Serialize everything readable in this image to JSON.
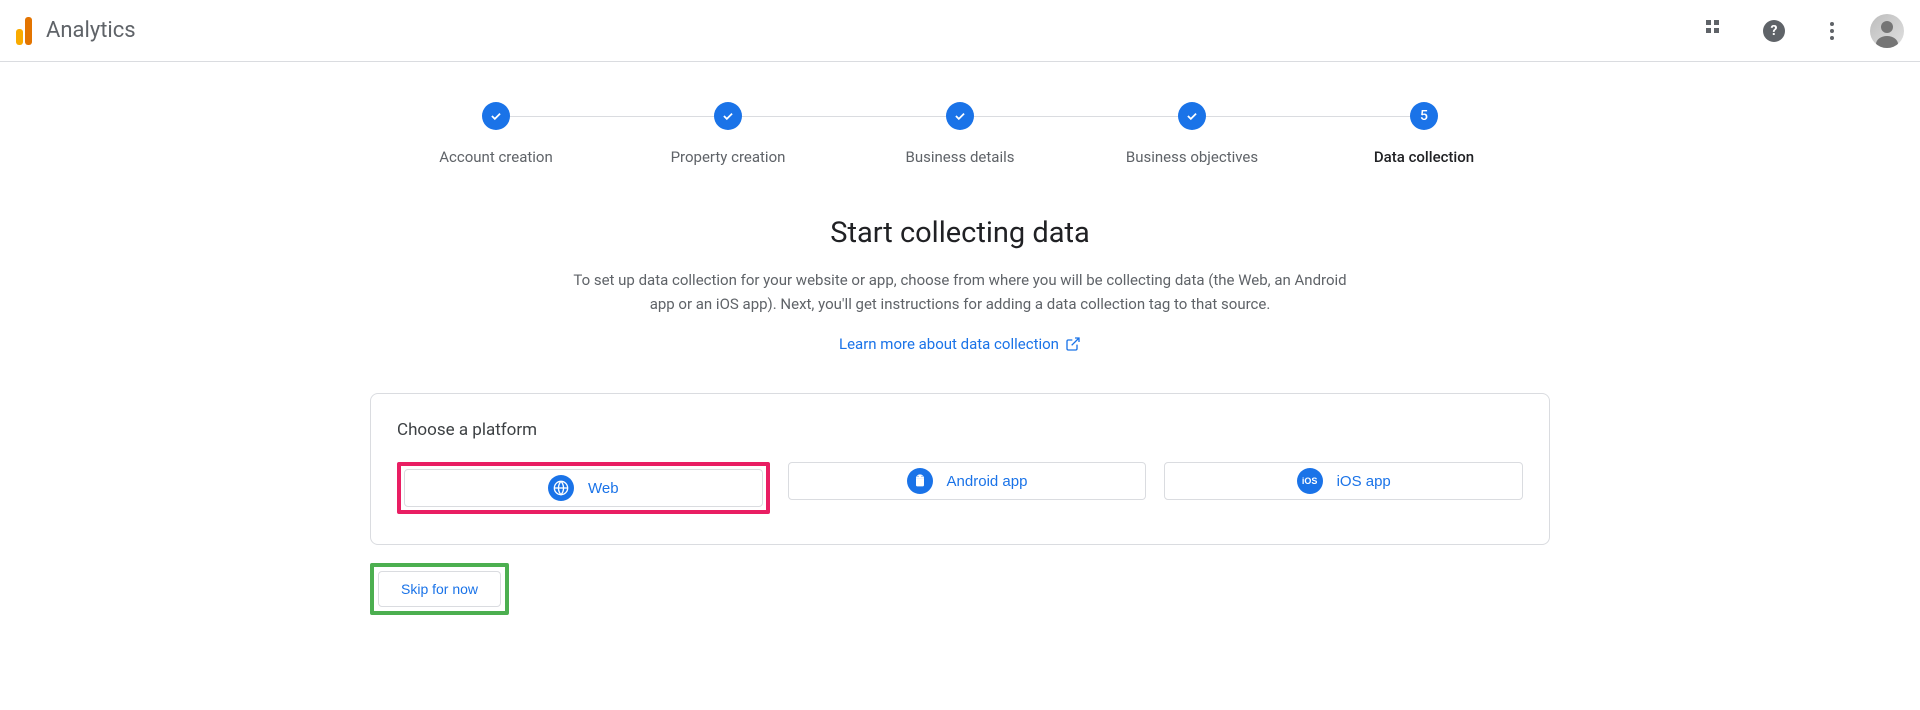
{
  "header": {
    "product_name": "Analytics"
  },
  "stepper": {
    "steps": [
      {
        "label": "Account creation",
        "done": true
      },
      {
        "label": "Property creation",
        "done": true
      },
      {
        "label": "Business details",
        "done": true
      },
      {
        "label": "Business objectives",
        "done": true
      },
      {
        "label": "Data collection",
        "number": "5",
        "active": true
      }
    ]
  },
  "content": {
    "heading": "Start collecting data",
    "description": "To set up data collection for your website or app, choose from where you will be collecting data (the Web, an Android app or an iOS app). Next, you'll get instructions for adding a data collection tag to that source.",
    "learn_link": "Learn more about data collection"
  },
  "card": {
    "title": "Choose a platform",
    "platforms": {
      "web": "Web",
      "android": "Android app",
      "ios": "iOS app"
    }
  },
  "skip": {
    "label": "Skip for now"
  }
}
